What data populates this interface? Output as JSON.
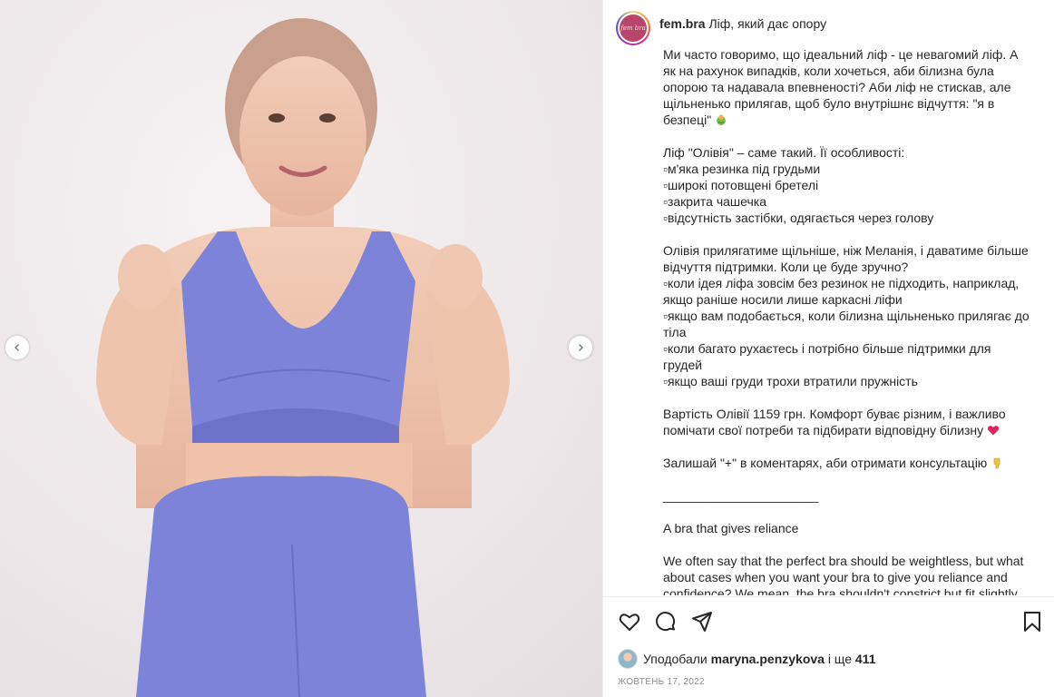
{
  "post": {
    "username": "fem.bra",
    "caption_title": "Ліф, який дає опору",
    "avatar_text": "fem bra"
  },
  "caption": {
    "p1_l1": "Ми часто говоримо, що ідеальний ліф - це невагомий ліф. А",
    "p1_l2": "як на рахунок випадків, коли хочеться, аби білизна була",
    "p1_l3": "опорою та надавала впевненості? Аби ліф не стискав, але",
    "p1_l4": "щільненько прилягав, щоб було внутрішнє відчуття: \"я в",
    "p1_l5": "безпеці\"",
    "p2_l1": "Ліф \"Олівія\" – саме такий. Її особливості:",
    "p2_l2": "▫м'яка резинка під грудьми",
    "p2_l3": "▫широкі потовщені бретелі",
    "p2_l4": "▫закрита чашечка",
    "p2_l5": "▫відсутність застібки, одягається через голову",
    "p3_l1": "Олівія прилягатиме щільніше, ніж Меланія, і даватиме більше",
    "p3_l2": "відчуття підтримки. Коли це буде зручно?",
    "p3_l3": "▫коли ідея ліфа зовсім без резинок не підходить, наприклад,",
    "p3_l4": "якщо раніше носили лише каркасні ліфи",
    "p3_l5": "▫якщо вам подобається, коли білизна щільненько прилягає до",
    "p3_l6": "тіла",
    "p3_l7": "▫коли багато рухаєтесь і потрібно більше підтримки для",
    "p3_l8": "грудей",
    "p3_l9": "▫якщо ваші груди трохи втратили пружність",
    "p4_l1": "Вартість Олівії 1159 грн. Комфорт буває різним, і важливо",
    "p4_l2": "помічати свої потреби та підбирати відповідну білизну",
    "p5_l1": "Залишай \"+\" в коментарях, аби отримати консультацію",
    "divider": "______________________",
    "en_title": "A bra that gives reliance",
    "en_l1": "We often say that the perfect bra should be weightless, but what",
    "en_l2": "about cases when you want your bra to give you reliance and",
    "en_l3": "confidence? We mean, the bra shouldn't constrict but fit slightly"
  },
  "likes": {
    "prefix": "Уподобали",
    "user": "maryna.penzykova",
    "middle": "і ще",
    "count": "411"
  },
  "date": "Жовтень 17, 2022",
  "icons": {
    "like": "heart-icon",
    "comment": "comment-icon",
    "share": "share-icon",
    "save": "bookmark-icon",
    "prev": "chevron-left-icon",
    "next": "chevron-right-icon"
  },
  "colors": {
    "garment": "#7c83d8",
    "background": "#f1ecee",
    "heart": "#e0245e"
  }
}
